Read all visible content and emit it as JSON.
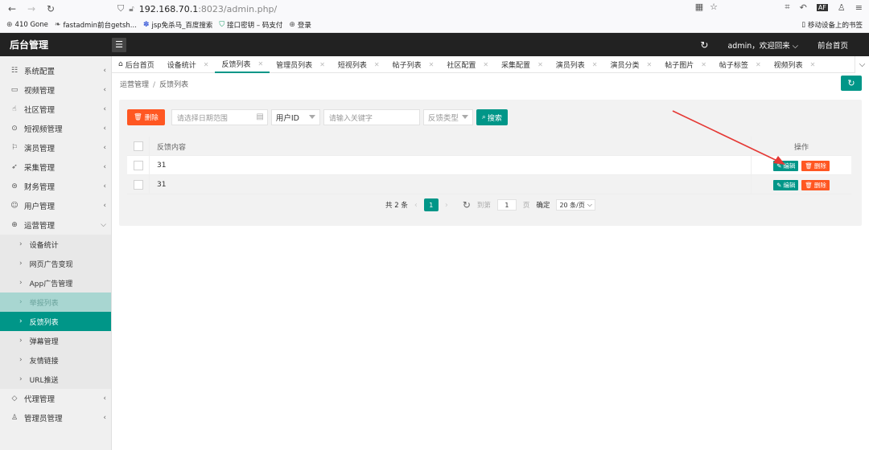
{
  "browser": {
    "url_host": "192.168.70.1",
    "url_rest": ":8023/admin.php/",
    "bookmarks": [
      "410 Gone",
      "fastadmin前台getsh...",
      "jsp免杀马_百度搜索",
      "接口密钥 – 码支付",
      "登录"
    ],
    "bookmark_right": "移动设备上的书签"
  },
  "header": {
    "logo": "后台管理",
    "user": "admin，欢迎回来",
    "frontend": "前台首页"
  },
  "sidebar": {
    "items": [
      {
        "label": "系统配置",
        "icon": "sliders-icon"
      },
      {
        "label": "视频管理",
        "icon": "video-icon"
      },
      {
        "label": "社区管理",
        "icon": "hand-icon"
      },
      {
        "label": "短视频管理",
        "icon": "play-circle-icon"
      },
      {
        "label": "演员管理",
        "icon": "flag-icon"
      },
      {
        "label": "采集管理",
        "icon": "send-icon"
      },
      {
        "label": "财务管理",
        "icon": "money-icon"
      },
      {
        "label": "用户管理",
        "icon": "user-card-icon"
      },
      {
        "label": "运营管理",
        "icon": "globe-icon"
      }
    ],
    "sub_items": [
      "设备统计",
      "网页广告变现",
      "App广告管理",
      "举报列表",
      "反馈列表",
      "弹幕管理",
      "友情链接",
      "URL推送"
    ],
    "bottom_items": [
      {
        "label": "代理管理",
        "icon": "diamond-icon"
      },
      {
        "label": "管理员管理",
        "icon": "person-icon"
      }
    ]
  },
  "tabs": [
    "后台首页",
    "设备统计",
    "反馈列表",
    "管理员列表",
    "短视列表",
    "帖子列表",
    "社区配置",
    "采集配置",
    "演员列表",
    "演员分类",
    "帖子图片",
    "帖子标签",
    "视频列表"
  ],
  "breadcrumb": {
    "parent": "运营管理",
    "current": "反馈列表"
  },
  "toolbar": {
    "delete_label": "删除",
    "date_placeholder": "请选择日期范围",
    "uid_select": "用户ID",
    "keyword_placeholder": "请输入关键字",
    "type_placeholder": "反馈类型",
    "search_label": "搜索"
  },
  "table": {
    "headers": [
      "反馈内容",
      "操作"
    ],
    "rows": [
      {
        "content": "31"
      },
      {
        "content": "31"
      }
    ],
    "edit_label": "编辑",
    "delete_label": "删除"
  },
  "pager": {
    "total": "共 2 条",
    "current": "1",
    "goto_prefix": "到第",
    "goto_value": "1",
    "goto_suffix": "页",
    "confirm": "确定",
    "page_size": "20 条/页"
  },
  "colors": {
    "accent": "#009688",
    "danger": "#ff5722",
    "annotation": "#e53935"
  }
}
